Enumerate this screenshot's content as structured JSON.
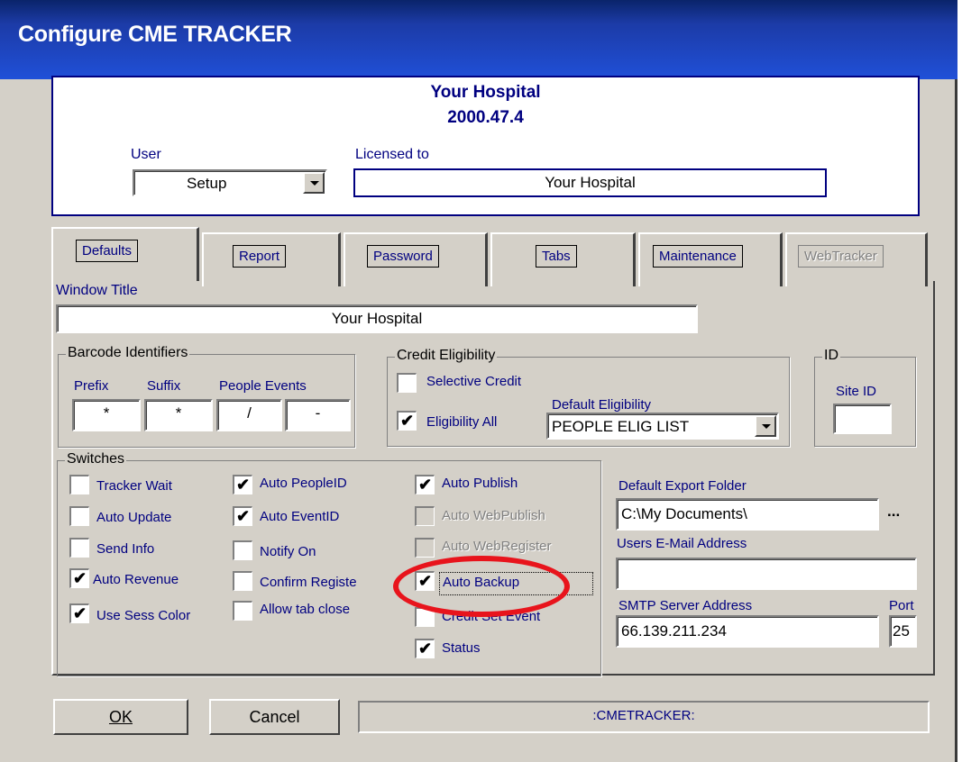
{
  "window": {
    "title": "Configure CME TRACKER"
  },
  "header": {
    "hospital": "Your Hospital",
    "version": "2000.47.4",
    "user_label": "User",
    "user_value": "Setup",
    "licensed_label": "Licensed to",
    "licensed_value": "Your Hospital"
  },
  "tabs": [
    {
      "label": "Defaults"
    },
    {
      "label": "Report"
    },
    {
      "label": "Password"
    },
    {
      "label": "Tabs"
    },
    {
      "label": "Maintenance"
    },
    {
      "label": "WebTracker"
    }
  ],
  "defaults": {
    "window_title_label": "Window Title",
    "window_title_value": "Your Hospital",
    "barcode": {
      "title": "Barcode Identifiers",
      "prefix_label": "Prefix",
      "suffix_label": "Suffix",
      "people_events_label": "People Events",
      "prefix": "*",
      "suffix": "*",
      "people": "/",
      "events": "-"
    },
    "credit": {
      "title": "Credit Eligibility",
      "selective": "Selective Credit",
      "default_label": "Default Eligibility",
      "eligibility_all": "Eligibility All",
      "default_value": "PEOPLE ELIG LIST"
    },
    "id": {
      "title": "ID",
      "site_label": "Site ID",
      "site_value": ""
    },
    "switches": {
      "title": "Switches",
      "items": {
        "tracker_wait": "Tracker Wait",
        "auto_update": "Auto Update",
        "send_info": "Send Info",
        "auto_revenue": "Auto Revenue",
        "use_sess_color": "Use Sess Color",
        "auto_peopleid": "Auto PeopleID",
        "auto_eventid": "Auto EventID",
        "notify_on": "Notify On",
        "confirm_register": "Confirm Registe",
        "allow_tab_close": "Allow tab close",
        "auto_publish": "Auto Publish",
        "auto_webpublish": "Auto WebPublish",
        "auto_webregister": "Auto WebRegister",
        "auto_backup": "Auto Backup",
        "credit_set_event": "Credit Set Event",
        "status": "Status"
      }
    },
    "export_label": "Default Export Folder",
    "export_value": "C:\\My Documents\\",
    "browse": "...",
    "email_label": "Users E-Mail Address",
    "email_value": "",
    "smtp_label": "SMTP Server Address",
    "smtp_value": "66.139.211.234",
    "port_label": "Port",
    "port_value": "25"
  },
  "buttons": {
    "ok": "OK",
    "cancel": "Cancel"
  },
  "statusbar": ":CMETRACKER:"
}
